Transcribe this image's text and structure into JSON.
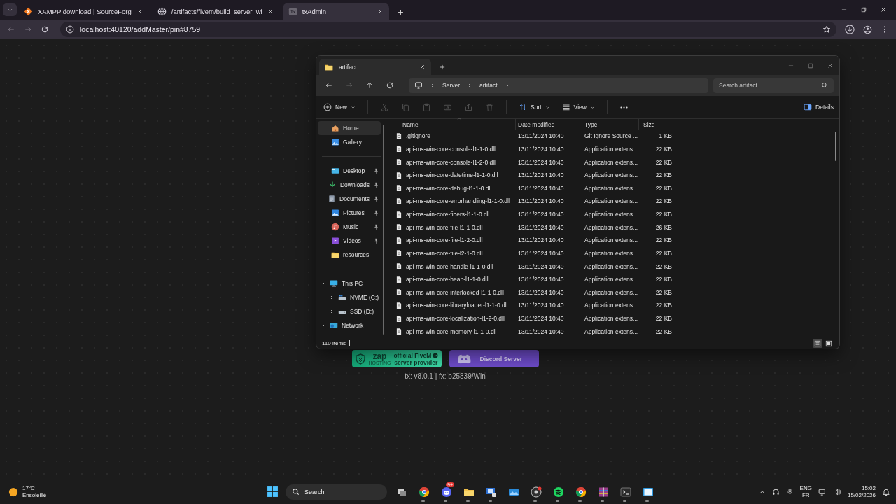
{
  "browser": {
    "tabs": [
      {
        "kind": "xampp",
        "title": "XAMPP download | SourceForg",
        "selected": false
      },
      {
        "kind": "globe",
        "title": "/artifacts/fivem/build_server_wi",
        "selected": false
      },
      {
        "kind": "txadmin",
        "title": "txAdmin",
        "selected": true
      }
    ],
    "url": "localhost:40120/addMaster/pin#8759"
  },
  "page": {
    "banners": [
      {
        "kind": "zap",
        "logo": "zap",
        "logo_sub": "HOSTING",
        "lines": [
          "official FiveM",
          "server provider"
        ]
      },
      {
        "kind": "discord",
        "lines": [
          "Discord Server"
        ]
      }
    ],
    "version": "tx: v8.0.1 | fx: b25839/Win"
  },
  "explorer": {
    "tab": {
      "title": "artifact"
    },
    "breadcrumb": [
      "Server",
      "artifact"
    ],
    "search": {
      "placeholder": "Search artifact"
    },
    "toolbar": {
      "new": "New",
      "sort": "Sort",
      "view": "View",
      "details": "Details"
    },
    "sidebar": {
      "sections": [
        {
          "items": [
            {
              "kind": "home",
              "label": "Home",
              "selected": true
            },
            {
              "kind": "gallery",
              "label": "Gallery",
              "selected": false
            }
          ]
        },
        {
          "items": [
            {
              "kind": "desktop",
              "label": "Desktop",
              "selected": false,
              "pinned": true
            },
            {
              "kind": "downloads",
              "label": "Downloads",
              "selected": false,
              "pinned": true
            },
            {
              "kind": "documents",
              "label": "Documents",
              "selected": false,
              "pinned": true
            },
            {
              "kind": "pictures",
              "label": "Pictures",
              "selected": false,
              "pinned": true
            },
            {
              "kind": "music",
              "label": "Music",
              "selected": false,
              "pinned": true
            },
            {
              "kind": "videos",
              "label": "Videos",
              "selected": false,
              "pinned": true
            },
            {
              "kind": "folder",
              "label": "resources",
              "selected": false,
              "pinned": false
            }
          ]
        },
        {
          "items": [
            {
              "kind": "pc",
              "label": "This PC",
              "selected": false,
              "expanded": true,
              "children": [
                {
                  "kind": "sysdrive",
                  "label": "NVME (C:)",
                  "selected": false,
                  "expanded": false
                },
                {
                  "kind": "drive",
                  "label": "SSD (D:)",
                  "selected": false,
                  "expanded": false
                }
              ]
            },
            {
              "kind": "network",
              "label": "Network",
              "selected": false,
              "expanded": false
            }
          ]
        }
      ]
    },
    "columns": [
      "Name",
      "Date modified",
      "Type",
      "Size"
    ],
    "files": [
      {
        "kind": "text",
        "name": ".gitignore",
        "date": "13/11/2024 10:40",
        "type": "Git Ignore Source ...",
        "size": "1 KB"
      },
      {
        "kind": "dll",
        "name": "api-ms-win-core-console-l1-1-0.dll",
        "date": "13/11/2024 10:40",
        "type": "Application extens...",
        "size": "22 KB"
      },
      {
        "kind": "dll",
        "name": "api-ms-win-core-console-l1-2-0.dll",
        "date": "13/11/2024 10:40",
        "type": "Application extens...",
        "size": "22 KB"
      },
      {
        "kind": "dll",
        "name": "api-ms-win-core-datetime-l1-1-0.dll",
        "date": "13/11/2024 10:40",
        "type": "Application extens...",
        "size": "22 KB"
      },
      {
        "kind": "dll",
        "name": "api-ms-win-core-debug-l1-1-0.dll",
        "date": "13/11/2024 10:40",
        "type": "Application extens...",
        "size": "22 KB"
      },
      {
        "kind": "dll",
        "name": "api-ms-win-core-errorhandling-l1-1-0.dll",
        "date": "13/11/2024 10:40",
        "type": "Application extens...",
        "size": "22 KB"
      },
      {
        "kind": "dll",
        "name": "api-ms-win-core-fibers-l1-1-0.dll",
        "date": "13/11/2024 10:40",
        "type": "Application extens...",
        "size": "22 KB"
      },
      {
        "kind": "dll",
        "name": "api-ms-win-core-file-l1-1-0.dll",
        "date": "13/11/2024 10:40",
        "type": "Application extens...",
        "size": "26 KB"
      },
      {
        "kind": "dll",
        "name": "api-ms-win-core-file-l1-2-0.dll",
        "date": "13/11/2024 10:40",
        "type": "Application extens...",
        "size": "22 KB"
      },
      {
        "kind": "dll",
        "name": "api-ms-win-core-file-l2-1-0.dll",
        "date": "13/11/2024 10:40",
        "type": "Application extens...",
        "size": "22 KB"
      },
      {
        "kind": "dll",
        "name": "api-ms-win-core-handle-l1-1-0.dll",
        "date": "13/11/2024 10:40",
        "type": "Application extens...",
        "size": "22 KB"
      },
      {
        "kind": "dll",
        "name": "api-ms-win-core-heap-l1-1-0.dll",
        "date": "13/11/2024 10:40",
        "type": "Application extens...",
        "size": "22 KB"
      },
      {
        "kind": "dll",
        "name": "api-ms-win-core-interlocked-l1-1-0.dll",
        "date": "13/11/2024 10:40",
        "type": "Application extens...",
        "size": "22 KB"
      },
      {
        "kind": "dll",
        "name": "api-ms-win-core-libraryloader-l1-1-0.dll",
        "date": "13/11/2024 10:40",
        "type": "Application extens...",
        "size": "22 KB"
      },
      {
        "kind": "dll",
        "name": "api-ms-win-core-localization-l1-2-0.dll",
        "date": "13/11/2024 10:40",
        "type": "Application extens...",
        "size": "22 KB"
      },
      {
        "kind": "dll",
        "name": "api-ms-win-core-memory-l1-1-0.dll",
        "date": "13/11/2024 10:40",
        "type": "Application extens...",
        "size": "22 KB"
      }
    ],
    "status": "110 items",
    "view_modes": [
      {
        "kind": "details",
        "selected": true
      },
      {
        "kind": "tiles",
        "selected": false
      }
    ]
  },
  "taskbar": {
    "weather": {
      "temp": "17°C",
      "condition": "Ensoleillé"
    },
    "search": {
      "placeholder": "Search"
    },
    "apps": [
      {
        "kind": "taskview",
        "running": false
      },
      {
        "kind": "browser",
        "running": true
      },
      {
        "kind": "chat",
        "running": true,
        "badge": "9+"
      },
      {
        "kind": "folder",
        "running": true
      },
      {
        "kind": "monitor",
        "running": true
      },
      {
        "kind": "photos",
        "running": false
      },
      {
        "kind": "recorder",
        "running": true
      },
      {
        "kind": "music",
        "running": true
      },
      {
        "kind": "browser",
        "running": true
      },
      {
        "kind": "archive",
        "running": true
      },
      {
        "kind": "terminal",
        "running": true
      },
      {
        "kind": "window",
        "running": true
      }
    ],
    "language": "ENG",
    "layout": "FR",
    "time": "15:02",
    "date": "15/02/2026"
  }
}
